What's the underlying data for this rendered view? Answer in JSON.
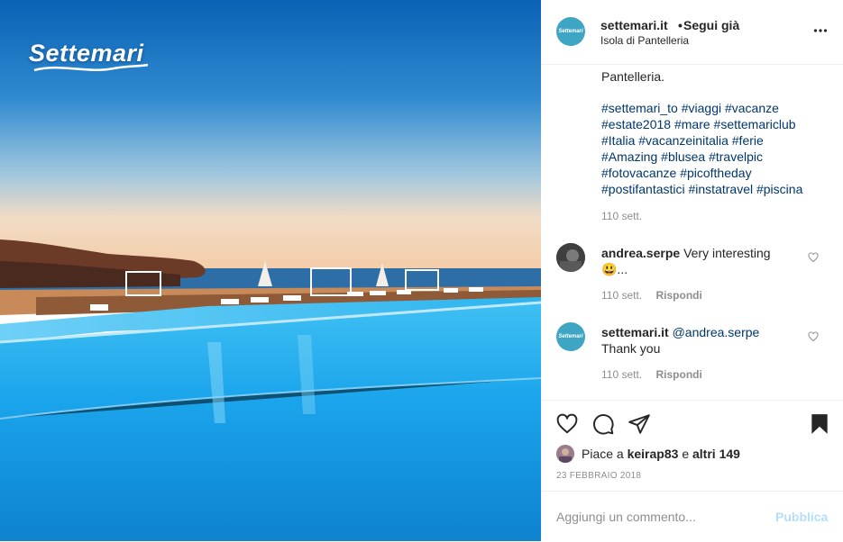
{
  "photo": {
    "alt_logo": "Settemari",
    "colors": {
      "sky_top": "#0a6fc0",
      "sky_bottom": "#f0d6b8",
      "pool": "#1aaef0",
      "sea": "#2b6fa8"
    }
  },
  "header": {
    "username": "settemari.it",
    "separator": "•",
    "follow_label": "Segui già",
    "location": "Isola di Pantelleria",
    "more_icon": "more-horizontal-icon"
  },
  "caption": {
    "text_end": "Pantelleria.",
    "hashtags": [
      "#settemari_to",
      "#viaggi",
      "#vacanze",
      "#estate2018",
      "#mare",
      "#settemariclub",
      "#Italia",
      "#vacanzeinitalia",
      "#ferie",
      "#Amazing",
      "#blusea",
      "#travelpic",
      "#fotovacanze",
      "#picoftheday",
      "#postifantastici",
      "#instatravel",
      "#piscina"
    ],
    "time": "110 sett."
  },
  "comments": [
    {
      "username": "andrea.serpe",
      "text": "Very interesting",
      "text_line2": "😃...",
      "time": "110 sett.",
      "reply_label": "Rispondi"
    },
    {
      "username": "settemari.it",
      "mention": "@andrea.serpe",
      "text": "Thank you",
      "time": "110 sett.",
      "reply_label": "Rispondi"
    }
  ],
  "actions": {
    "icons": [
      "heart-icon",
      "comment-icon",
      "share-icon",
      "bookmark-icon"
    ],
    "likes_prefix": "Piace a",
    "likes_user": "keirap83",
    "likes_connector": "e",
    "likes_others": "altri 149",
    "date": "23 FEBBRAIO 2018"
  },
  "comment_box": {
    "placeholder": "Aggiungi un commento...",
    "publish_label": "Pubblica",
    "publish_color": "#b2dffc"
  }
}
